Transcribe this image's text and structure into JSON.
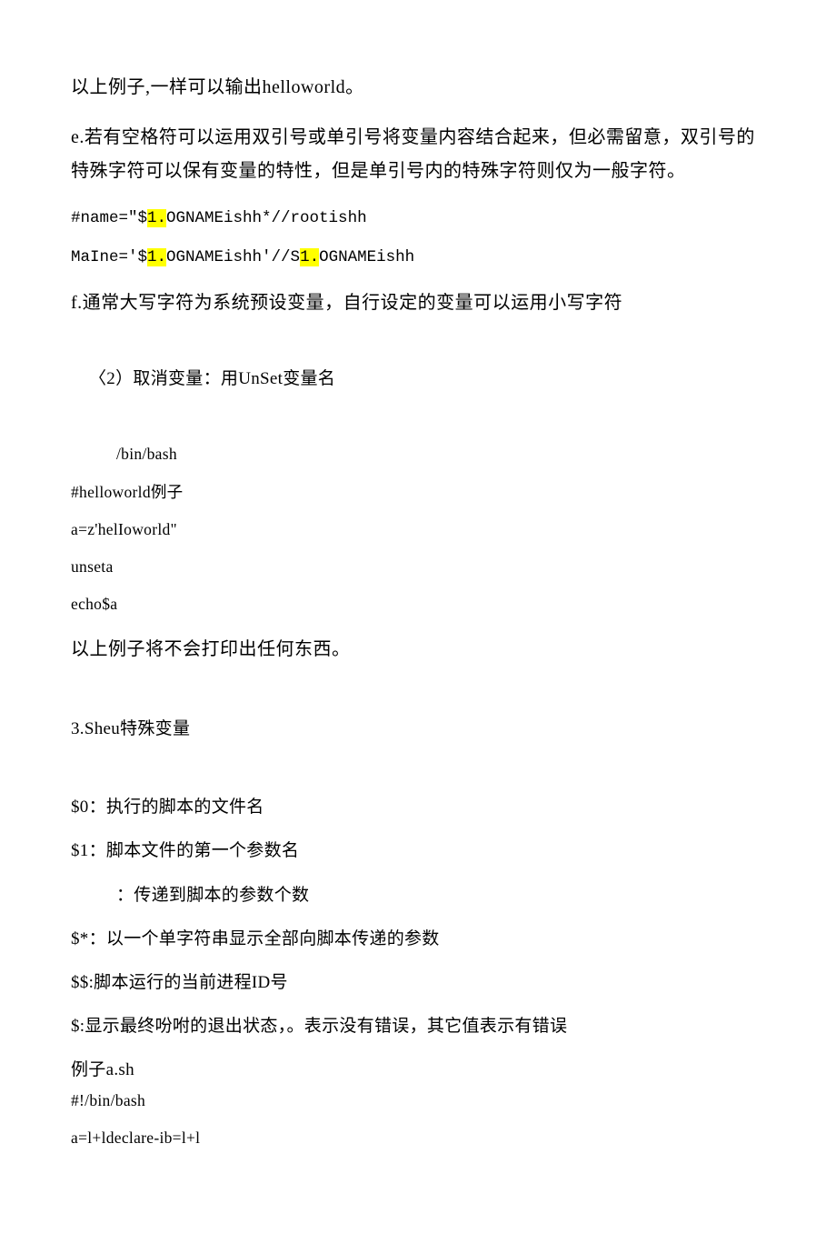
{
  "p01": "以上例子,一样可以输出helloworld。",
  "p02": "e.若有空格符可以运用双引号或单引号将变量内容结合起来，但必需留意，双引号的特殊字符可以保有变量的特性，但是单引号内的特殊字符则仅为一般字符。",
  "p03a": "#name=\"$",
  "p03b": "1.",
  "p03c": "OGNAMEishh*//rootishh",
  "p04a": "MaIne='$",
  "p04b": "1.",
  "p04c": "OGNAMEishh'//S",
  "p04d": "1.",
  "p04e": "OGNAMEishh",
  "p05": "f.通常大写字符为系统预设变量，自行设定的变量可以运用小写字符",
  "p06": "〈2）取消变量：用UnSet变量名",
  "p07": "/bin/bash",
  "p08": "#helloworld例子",
  "p09": "a=z'helIoworld\"",
  "p10": "unseta",
  "p11": "echo$a",
  "p12": "以上例子将不会打印出任何东西。",
  "p13": "3.Sheu特殊变量",
  "p14": "$0：执行的脚本的文件名",
  "p15": "$1：脚本文件的第一个参数名",
  "p16": "：传递到脚本的参数个数",
  "p17": "$*：以一个单字符串显示全部向脚本传递的参数",
  "p18": "$$:脚本运行的当前进程ID号",
  "p19": "$:显示最终吩咐的退出状态，。表示没有错误，其它值表示有错误",
  "p20": "例子a.sh",
  "p21": "#!/bin/bash",
  "p22": "a=l+ldeclare-ib=l+l"
}
